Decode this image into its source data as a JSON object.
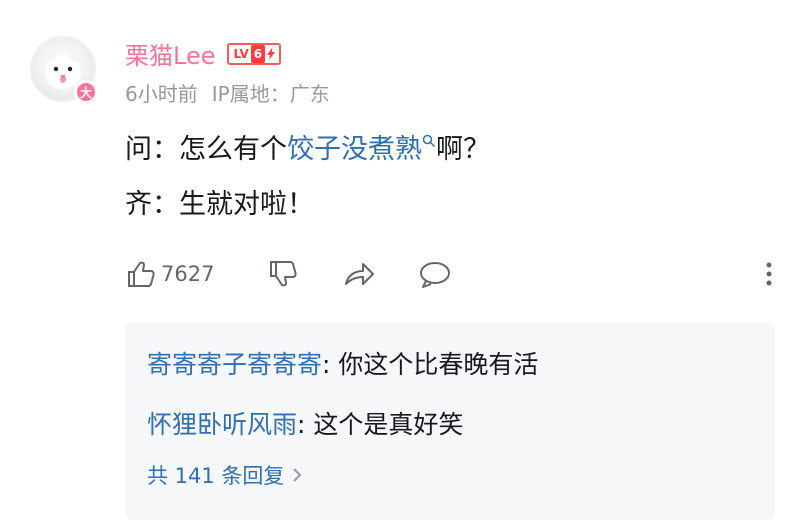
{
  "comment": {
    "username": "栗猫Lee",
    "level_badge": {
      "prefix": "LV",
      "level": "6"
    },
    "official_badge": "大",
    "time": "6小时前",
    "ip_location": "IP属地：广东",
    "lines": [
      {
        "speaker": "问：",
        "before": "怎么有个",
        "link": "饺子没煮熟",
        "after": "啊？"
      },
      {
        "speaker": "齐：",
        "text": "生就对啦！"
      }
    ],
    "like_count": "7627"
  },
  "replies": [
    {
      "user": "寄寄寄子寄寄寄",
      "text": "你这个比春晚有活"
    },
    {
      "user": "怀狸卧听风雨",
      "text": "这个是真好笑"
    }
  ],
  "view_all_replies": "共 141 条回复",
  "colors": {
    "username": "#fb7299",
    "link": "#2f6fb4",
    "meta": "#9499a0",
    "reply_bg": "#f6f7f8"
  }
}
